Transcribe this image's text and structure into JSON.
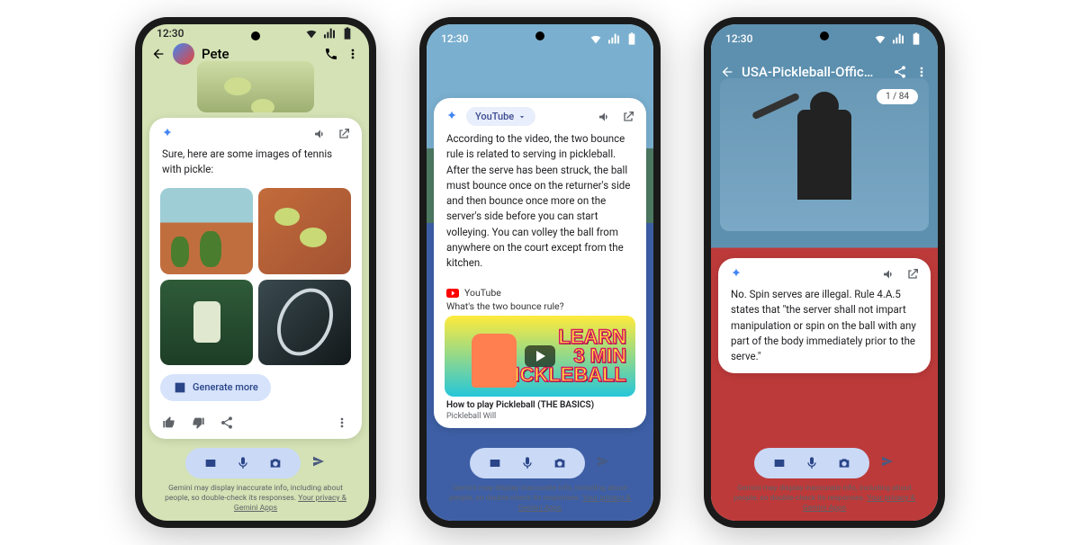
{
  "status": {
    "time": "12:30"
  },
  "disclaimer": {
    "text_a": "Gemini may display inaccurate info, including about people, so double-check its responses. ",
    "link": "Your privacy & Gemini Apps"
  },
  "phone1": {
    "contact": "Pete",
    "card": {
      "prompt": "Sure, here are some images of tennis with pickle:",
      "generate": "Generate more"
    }
  },
  "phone2": {
    "chip": "YouTube",
    "body": "According to the video, the two bounce rule is related to serving in pickleball. After the serve has been struck, the ball must bounce once on the returner's side and then bounce once more on the server's side before you can start volleying. You can volley the ball from anywhere on the court except from the kitchen.",
    "yt_label": "YouTube",
    "yt_question": "What's the two bounce rule?",
    "yt_thumb_line1": "LEARN",
    "yt_thumb_line2": "3 MIN",
    "yt_thumb_line3": "PICKLEBALL",
    "yt_title": "How to play Pickleball (THE BASICS)",
    "yt_channel": "Pickleball Will"
  },
  "phone3": {
    "title": "USA-Pickleball-Official-...",
    "page": "1 / 84",
    "body": "No. Spin serves are illegal. Rule 4.A.5 states that \"the server shall not impart manipulation or spin on the ball with any part of the body immediately prior to the serve.\""
  }
}
